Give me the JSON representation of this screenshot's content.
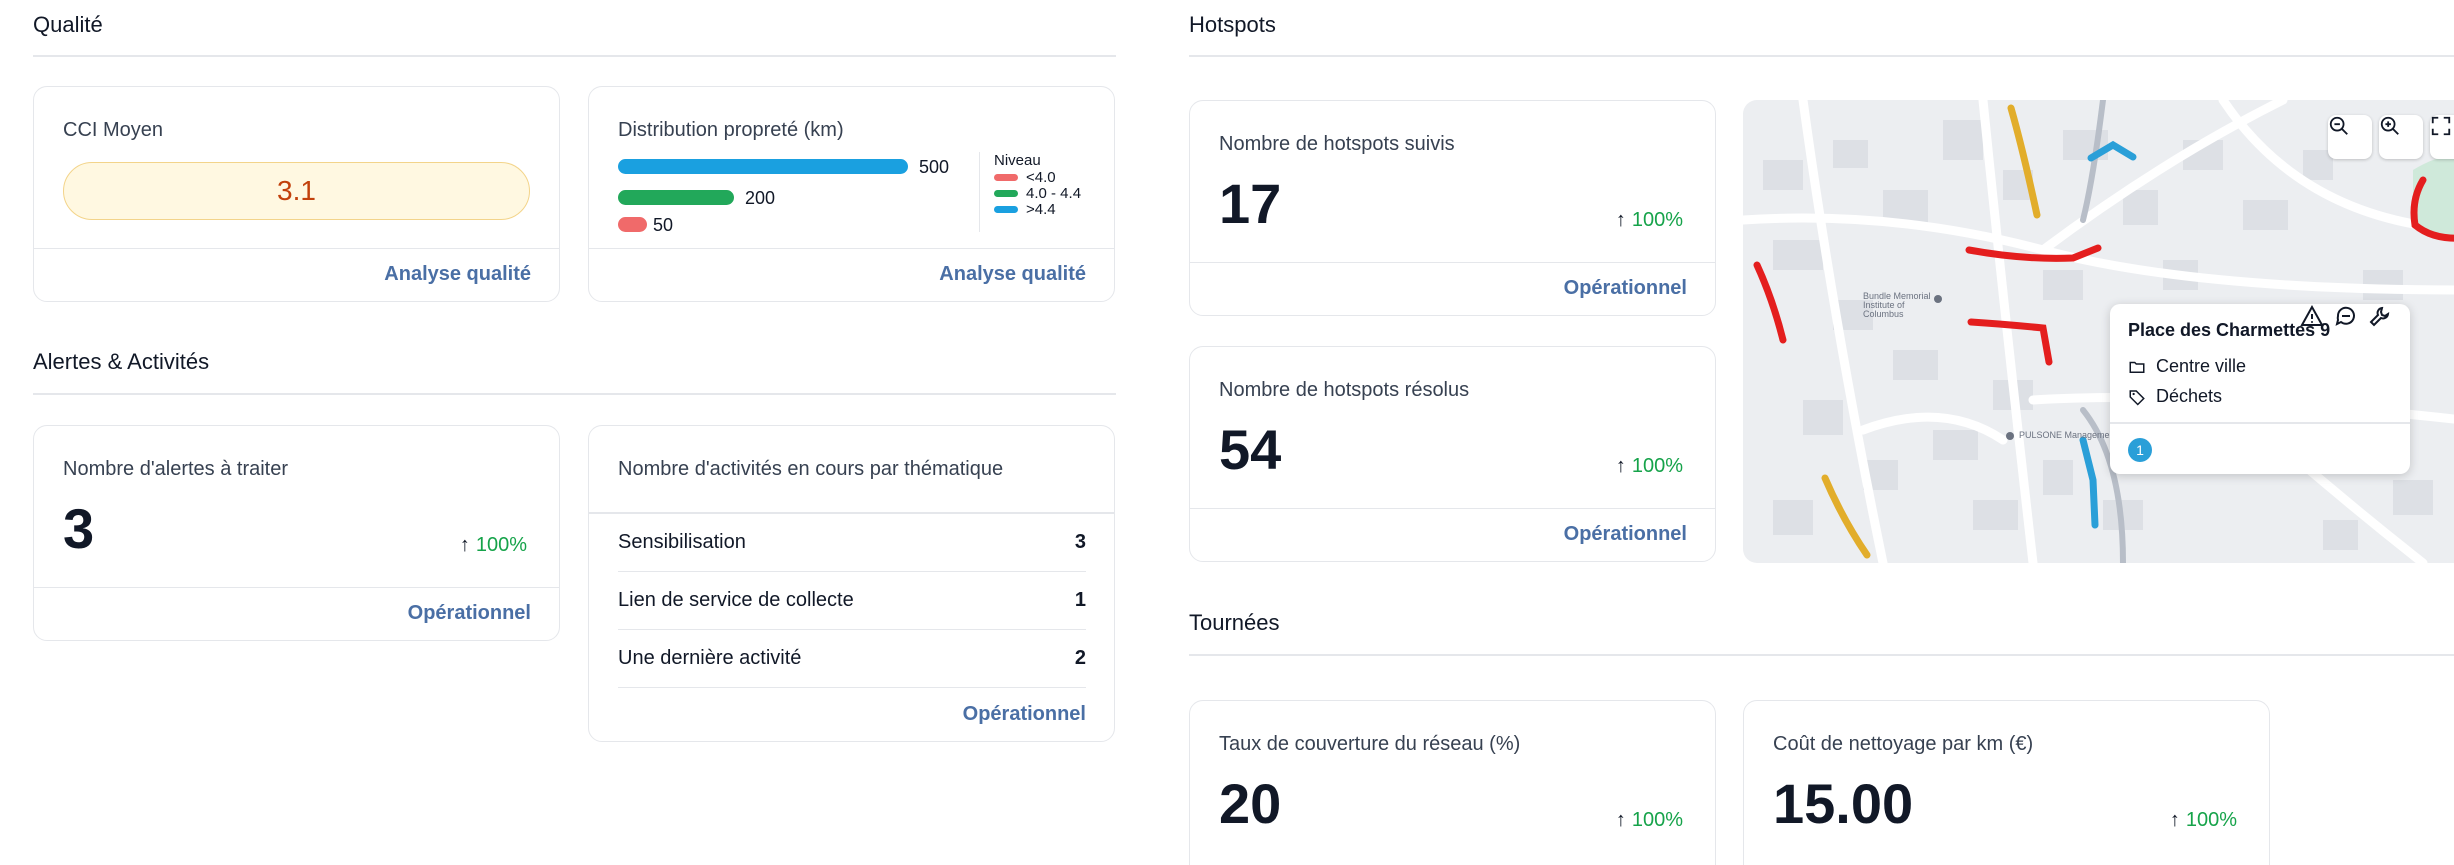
{
  "sections": {
    "qualite": "Qualité",
    "alertes": "Alertes & Activités",
    "hotspots": "Hotspots",
    "tournees": "Tournées"
  },
  "cci": {
    "title": "CCI Moyen",
    "value": "3.1",
    "link": "Analyse qualité"
  },
  "distribution": {
    "title": "Distribution propreté (km)",
    "link": "Analyse qualité",
    "bars": [
      {
        "value": "500",
        "level": ">4.4",
        "color": "#1aa0e0"
      },
      {
        "value": "200",
        "level": "4.0 - 4.4",
        "color": "#22a85a"
      },
      {
        "value": "50",
        "level": "<4.0",
        "color": "#f06a6a"
      }
    ],
    "legend_title": "Niveau",
    "legend": [
      {
        "label": "<4.0",
        "color": "#f06a6a"
      },
      {
        "label": "4.0 - 4.4",
        "color": "#22a85a"
      },
      {
        "label": ">4.4",
        "color": "#1aa0e0"
      }
    ]
  },
  "alerts": {
    "title": "Nombre d'alertes à traiter",
    "value": "3",
    "trend": "100%",
    "link": "Opérationnel"
  },
  "activities": {
    "title": "Nombre d'activités en cours par thématique",
    "rows": [
      {
        "label": "Sensibilisation",
        "value": "3"
      },
      {
        "label": "Lien de service de collecte",
        "value": "1"
      },
      {
        "label": "Une dernière activité",
        "value": "2"
      }
    ],
    "link": "Opérationnel"
  },
  "hotspots_followed": {
    "title": "Nombre de hotspots suivis",
    "value": "17",
    "trend": "100%",
    "link": "Opérationnel"
  },
  "hotspots_resolved": {
    "title": "Nombre de hotspots résolus",
    "value": "54",
    "trend": "100%",
    "link": "Opérationnel"
  },
  "map": {
    "zoom_out_icon": "zoom-out-icon",
    "zoom_in_icon": "zoom-in-icon",
    "fullscreen_icon": "fullscreen-icon",
    "poi_labels": [
      "Bundle Memorial Institute of Columbus",
      "PULSONE Management"
    ],
    "popup": {
      "title": "Place des Charmettes 9",
      "folder": "Centre ville",
      "tag": "Déchets",
      "badge": "1"
    }
  },
  "coverage": {
    "title": "Taux de couverture du réseau (%)",
    "value": "20",
    "trend": "100%"
  },
  "cleaning_cost": {
    "title": "Coût de nettoyage par km (€)",
    "value": "15.00",
    "trend": "100%"
  }
}
